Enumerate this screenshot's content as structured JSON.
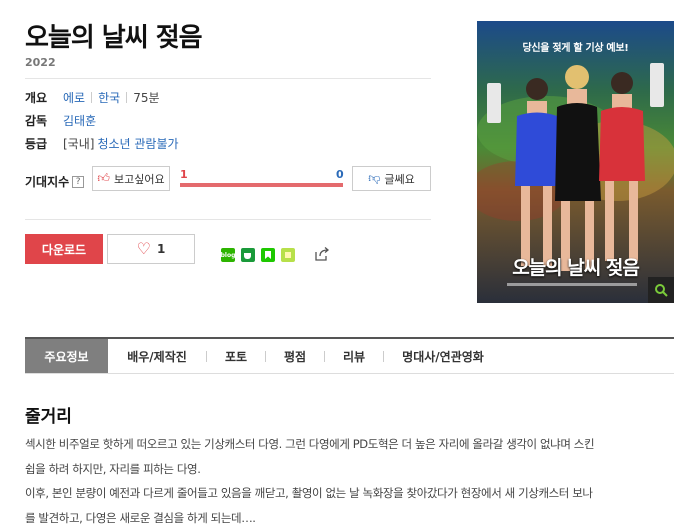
{
  "movie": {
    "title": "오늘의 날씨 젖음",
    "year": "2022"
  },
  "overview": {
    "label": "개요",
    "genre": "에로",
    "country": "한국",
    "runtime": "75분"
  },
  "director": {
    "label": "감독",
    "name": "김태훈"
  },
  "rating": {
    "label": "등급",
    "region": "[국내]",
    "grade": "청소년 관람불가"
  },
  "expectation": {
    "label": "기대지수",
    "help": "?",
    "want_label": "보고싶어요",
    "want_count": "1",
    "dislike_label": "글쎄요",
    "dislike_count": "0",
    "want_ratio": 1.0
  },
  "actions": {
    "download_label": "다운로드",
    "like_count": "1"
  },
  "share_icons": [
    "blog-icon",
    "cafe-icon",
    "bookmark-icon",
    "memo-icon"
  ],
  "poster": {
    "tagline": "당신을 젖게 할 기상 예보!",
    "title": "오늘의 날씨 젖음"
  },
  "tabs": [
    "주요정보",
    "배우/제작진",
    "포토",
    "평점",
    "리뷰",
    "명대사/연관영화"
  ],
  "synopsis": {
    "title": "줄거리",
    "lines": [
      "섹시한 비주얼로 핫하게 떠오르고 있는 기상캐스터 다영. 그런 다영에게 PD도혁은 더 높은 자리에 올라갈 생각이 없냐며 스킨",
      "쉽을 하려 하지만, 자리를 피하는 다영.",
      " 이후, 본인 분량이 예전과 다르게 줄어들고 있음을 깨닫고, 촬영이 없는 날 녹화장을 찾아갔다가 현장에서 새 기상캐스터 보나",
      "를 발견하고, 다영은 새로운 결심을 하게 되는데…."
    ]
  },
  "colors": {
    "accent_red": "#e0454a",
    "link_blue": "#2a6ab8",
    "tab_active": "#7f7f7f"
  }
}
